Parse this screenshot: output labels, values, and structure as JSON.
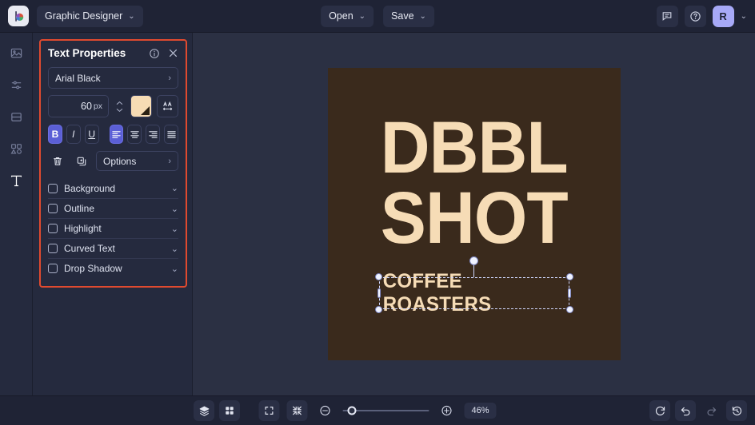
{
  "header": {
    "logo_icon": "color-wheel-logo-icon",
    "document_name": "Graphic Designer",
    "document_chevron": "⌄",
    "open_label": "Open",
    "save_label": "Save",
    "chevron": "⌄",
    "comment_icon": "comment-icon",
    "help_icon": "help-circle-icon",
    "avatar_initial": "R",
    "avatar_chevron": "⌄"
  },
  "rail": {
    "items": [
      {
        "icon": "image-icon",
        "name": "sidebar-item-image",
        "active": false
      },
      {
        "icon": "adjustments-icon",
        "name": "sidebar-item-adjustments",
        "active": false
      },
      {
        "icon": "layout-icon",
        "name": "sidebar-item-layout",
        "active": false
      },
      {
        "icon": "shapes-icon",
        "name": "sidebar-item-shapes",
        "active": false
      },
      {
        "icon": "text-icon",
        "name": "sidebar-item-text",
        "active": true
      }
    ]
  },
  "panel": {
    "title": "Text Properties",
    "info_icon": "info-circle-icon",
    "close_icon": "close-icon",
    "highlight_color": "#e04a2f",
    "font_family": "Arial Black",
    "font_family_chevron": "›",
    "font_size": "60",
    "font_size_unit": "px",
    "color_swatch": "#f7dcb4",
    "letter_spacing_icon": "letter-spacing-icon",
    "format_buttons": [
      {
        "label": "B",
        "name": "bold-button",
        "active": true
      },
      {
        "label": "I",
        "name": "italic-button",
        "active": false
      },
      {
        "label": "U",
        "name": "underline-button",
        "active": false
      }
    ],
    "align_buttons": [
      {
        "name": "align-left-button",
        "active": true
      },
      {
        "name": "align-center-button",
        "active": false
      },
      {
        "name": "align-right-button",
        "active": false
      },
      {
        "name": "align-justify-button",
        "active": false
      }
    ],
    "delete_icon": "trash-icon",
    "duplicate_icon": "duplicate-icon",
    "options_label": "Options",
    "options_chevron": "›",
    "accordions": [
      {
        "label": "Background",
        "checked": false,
        "chevron": "⌄"
      },
      {
        "label": "Outline",
        "checked": false,
        "chevron": "⌄"
      },
      {
        "label": "Highlight",
        "checked": false,
        "chevron": "⌄"
      },
      {
        "label": "Curved Text",
        "checked": false,
        "chevron": "⌄"
      },
      {
        "label": "Drop Shadow",
        "checked": false,
        "chevron": "⌄"
      }
    ]
  },
  "canvas": {
    "background_color": "#2b3043",
    "artboard_color": "#3a2a1c",
    "text_color": "#f6dcb6",
    "line1": "DBBL",
    "line2": "SHOT",
    "selected_text": "COFFEE ROASTERS"
  },
  "footer": {
    "layers_icon": "layers-icon",
    "grid_icon": "grid-icon",
    "fit_icon": "fit-to-screen-icon",
    "shrink_icon": "shrink-to-selection-icon",
    "zoom_out_icon": "zoom-out-icon",
    "zoom_in_icon": "zoom-in-icon",
    "zoom_percent": "46%",
    "reset_icon": "reset-icon",
    "undo_icon": "undo-icon",
    "redo_icon": "redo-icon",
    "history_icon": "history-icon"
  }
}
